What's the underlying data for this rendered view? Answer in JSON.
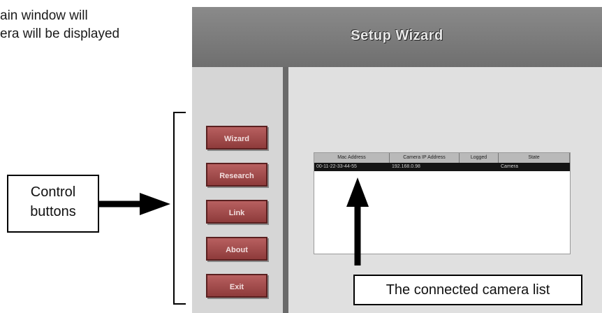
{
  "intro_text": {
    "line1": "ain window will",
    "line2": "era will be displayed"
  },
  "window": {
    "title": "Setup Wizard",
    "control_buttons": [
      {
        "label": "Wizard"
      },
      {
        "label": "Research"
      },
      {
        "label": "Link"
      },
      {
        "label": "About"
      },
      {
        "label": "Exit"
      }
    ],
    "camera_list": {
      "columns": [
        "Mac Address",
        "Camera IP Address",
        "Logged",
        "State"
      ],
      "rows": [
        {
          "mac": "00-11-22-33-44-55",
          "ip": "192.168.0.98",
          "logged": "",
          "state": "Camera"
        }
      ]
    }
  },
  "annotations": {
    "control_buttons_line1": "Control",
    "control_buttons_line2": "buttons",
    "camera_list_label": "The connected camera list"
  },
  "colors": {
    "titlebar": "#7a7a7a",
    "button_fill": "#a24c4c",
    "divider": "#6a6a6a"
  }
}
